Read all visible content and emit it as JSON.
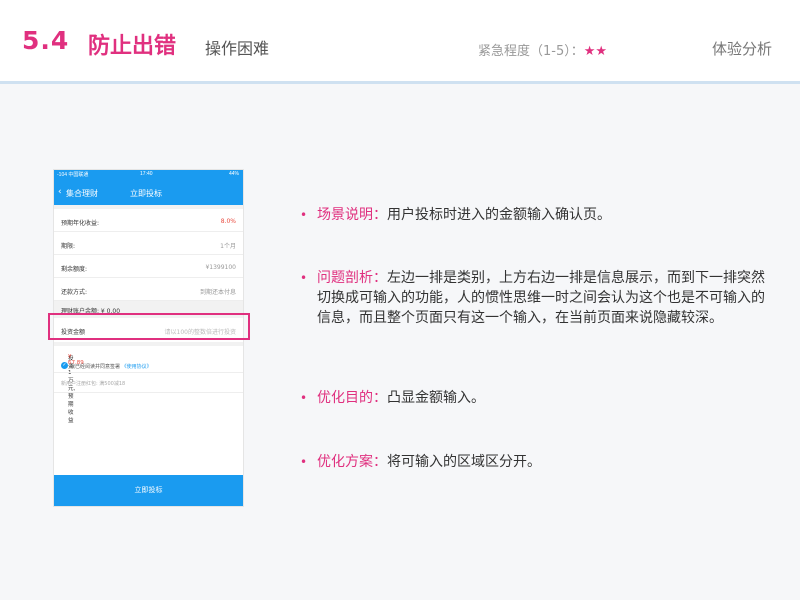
{
  "header": {
    "section_number": "5.4",
    "section_title": "防止出错",
    "section_subtitle": "操作困难",
    "urgency_label": "紧急程度（1-5）：",
    "urgency_stars": "★★",
    "category": "体验分析"
  },
  "phone": {
    "status": {
      "carrier": "-104 中国联通",
      "time": "17:40",
      "battery": "44%"
    },
    "nav": {
      "back_icon": "‹",
      "back_label": "集合理财",
      "title": "立即投标"
    },
    "rows": [
      {
        "label": "预期年化收益:",
        "value": "8.0%"
      },
      {
        "label": "期限:",
        "value": "1个月"
      },
      {
        "label": "剩余额度:",
        "value": "¥1399100"
      },
      {
        "label": "还款方式:",
        "value": "到期还本付息"
      }
    ],
    "balance": "理财账户余额: ¥ 0.00",
    "invest_label": "投资金额",
    "invest_placeholder": "请以100的整数倍进行投资",
    "expected_prefix": "投资1万元,预期收益 ",
    "expected_value": "¥ 67.89",
    "agree_text": "我已经阅读并同意签署 ",
    "agree_link": "《使用协议》",
    "newbie": "新用户注册红包: 满500减18",
    "submit": "立即投标"
  },
  "bullets": [
    {
      "head": "场景说明：",
      "text": "用户投标时进入的金额输入确认页。"
    },
    {
      "head": "问题剖析：",
      "text": "左边一排是类别，上方右边一排是信息展示，而到下一排突然切换成可输入的功能，人的惯性思维一时之间会认为这个也是不可输入的信息，而且整个页面只有这一个输入，在当前页面来说隐藏较深。"
    },
    {
      "head": "优化目的：",
      "text": "凸显金额输入。"
    },
    {
      "head": "优化方案：",
      "text": "将可输入的区域区分开。"
    }
  ]
}
